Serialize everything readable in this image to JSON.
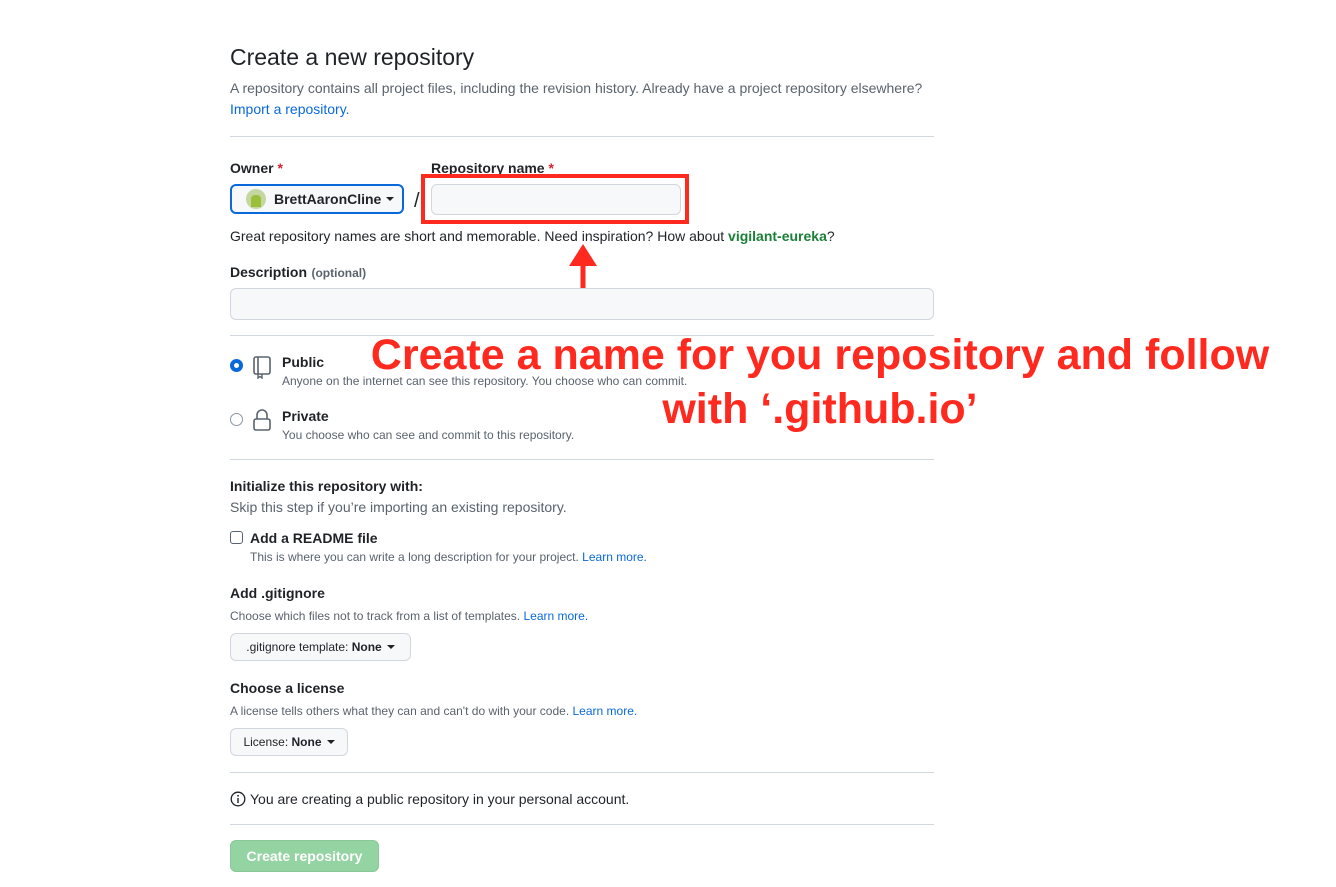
{
  "header": {
    "title": "Create a new repository",
    "intro": "A repository contains all project files, including the revision history. Already have a project repository elsewhere?",
    "import_link": "Import a repository."
  },
  "owner": {
    "label": "Owner",
    "required_mark": "*",
    "value": "BrettAaronCline"
  },
  "separator": "/",
  "repo_name": {
    "label": "Repository name",
    "required_mark": "*",
    "value": "",
    "hint_prefix": "Great repository names are short and memorable. Need inspiration? How about",
    "suggestion": "vigilant-eureka",
    "hint_suffix": "?"
  },
  "description": {
    "label": "Description",
    "optional": "(optional)",
    "value": ""
  },
  "annotation": {
    "line1": "Create a name for you repository and follow",
    "line2": "with ‘.github.io’",
    "color": "#ff2a1f"
  },
  "visibility": {
    "public": {
      "label": "Public",
      "desc": "Anyone on the internet can see this repository. You choose who can commit.",
      "selected": true,
      "icon": "repo-icon"
    },
    "private": {
      "label": "Private",
      "desc": "You choose who can see and commit to this repository.",
      "selected": false,
      "icon": "lock-icon"
    }
  },
  "init": {
    "title": "Initialize this repository with:",
    "subtitle": "Skip this step if you’re importing an existing repository.",
    "readme_label": "Add a README file",
    "readme_desc": "This is where you can write a long description for your project.",
    "readme_checked": false,
    "learn_more": "Learn more."
  },
  "gitignore": {
    "title": "Add .gitignore",
    "desc": "Choose which files not to track from a list of templates.",
    "learn_more": "Learn more.",
    "button_prefix": ".gitignore template:",
    "button_value": "None"
  },
  "license": {
    "title": "Choose a license",
    "desc": "A license tells others what they can and can't do with your code.",
    "learn_more": "Learn more.",
    "button_prefix": "License:",
    "button_value": "None"
  },
  "notice": "You are creating a public repository in your personal account.",
  "submit": "Create repository",
  "colors": {
    "link": "#0969da",
    "suggestion": "#1a7f37",
    "create_button": "#94d3a2",
    "highlight": "#ff2a1f"
  }
}
